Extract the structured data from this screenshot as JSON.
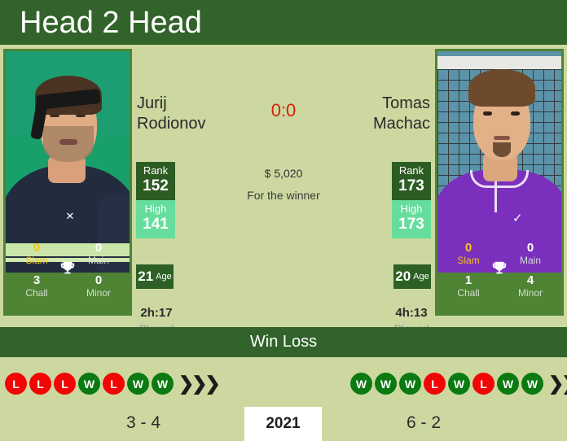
{
  "header": {
    "title": "Head 2 Head"
  },
  "match": {
    "score": "0:0",
    "prize_amount": "$ 5,020",
    "prize_label": "For the winner"
  },
  "players": [
    {
      "side": "left",
      "first_name": "Jurij",
      "last_name": "Rodionov",
      "rank_label": "Rank",
      "rank_value": "152",
      "high_label": "High",
      "high_value": "141",
      "age_value": "21",
      "age_label": "Age",
      "played_value": "2h:17",
      "played_label": "Played",
      "titles": {
        "slam_value": "0",
        "slam_label": "Slam",
        "main_value": "0",
        "main_label": "Main",
        "chall_value": "3",
        "chall_label": "Chall",
        "minor_value": "0",
        "minor_label": "Minor",
        "trophy_icon": "trophy-icon"
      },
      "streak": [
        "L",
        "L",
        "L",
        "W",
        "L",
        "W",
        "W"
      ],
      "season_record": "3 - 4"
    },
    {
      "side": "right",
      "first_name": "Tomas",
      "last_name": "Machac",
      "rank_label": "Rank",
      "rank_value": "173",
      "high_label": "High",
      "high_value": "173",
      "age_value": "20",
      "age_label": "Age",
      "played_value": "4h:13",
      "played_label": "Played",
      "titles": {
        "slam_value": "0",
        "slam_label": "Slam",
        "main_value": "0",
        "main_label": "Main",
        "chall_value": "1",
        "chall_label": "Chall",
        "minor_value": "4",
        "minor_label": "Minor",
        "trophy_icon": "trophy-icon"
      },
      "streak": [
        "W",
        "W",
        "W",
        "L",
        "W",
        "L",
        "W",
        "W"
      ],
      "season_record": "6 - 2"
    }
  ],
  "winloss": {
    "title": "Win Loss",
    "year": "2021",
    "more_icon": "chevron-right-triple-icon"
  },
  "colors": {
    "header_green": "#31632a",
    "panel_khaki": "#ccd8a0",
    "photo_green": "#4e8434",
    "rank_dark": "#2d5c23",
    "high_light": "#66dd9d",
    "score_red": "#d81f06",
    "slam_gold": "#f5c518",
    "win_green": "#0b7a10",
    "loss_red": "#f20505"
  }
}
